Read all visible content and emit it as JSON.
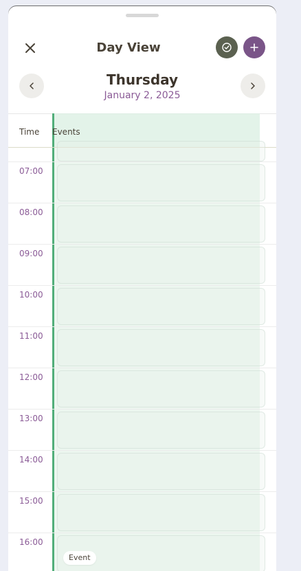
{
  "header": {
    "title": "Day View",
    "close_icon": "close-icon",
    "complete_icon": "check-circle-icon",
    "add_icon": "plus-icon",
    "complete_color": "#5b6150",
    "add_color": "#7a5588"
  },
  "date_nav": {
    "day_name": "Thursday",
    "date": "January 2, 2025",
    "prev_icon": "chevron-left-icon",
    "next_icon": "chevron-right-icon"
  },
  "columns": {
    "time": "Time",
    "events": "Events"
  },
  "hours": [
    "07:00",
    "08:00",
    "09:00",
    "10:00",
    "11:00",
    "12:00",
    "13:00",
    "14:00",
    "15:00",
    "16:00"
  ],
  "event": {
    "label": "Event",
    "color": "#52ae7a"
  }
}
